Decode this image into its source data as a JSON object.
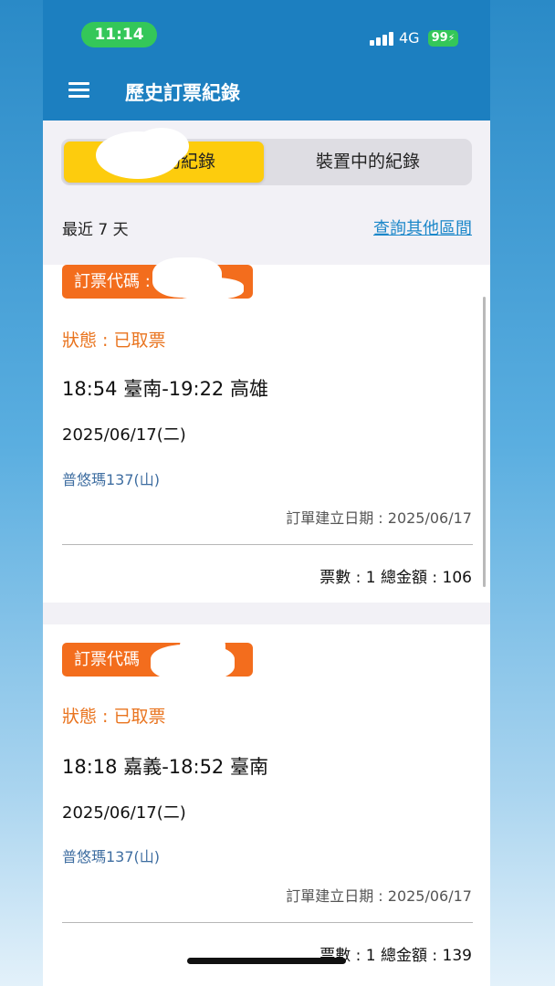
{
  "status_bar": {
    "time": "11:14",
    "network": "4G",
    "battery": "99"
  },
  "nav": {
    "title": "歷史訂票紀錄"
  },
  "segment": {
    "active_label": "的紀錄",
    "inactive_label": "裝置中的紀錄"
  },
  "filter": {
    "range_label": "最近 7 天",
    "other_range_link": "查詢其他區間"
  },
  "records": [
    {
      "code_label": "訂票代碼 :",
      "status": "狀態 : 已取票",
      "route": "18:54 臺南-19:22 高雄",
      "date": "2025/06/17(二)",
      "train": "普悠瑪137(山)",
      "created": "訂單建立日期 : 2025/06/17",
      "total": "票數 : 1  總金額 : 106"
    },
    {
      "code_label": "訂票代碼",
      "status": "狀態 : 已取票",
      "route": "18:18 嘉義-18:52 臺南",
      "date": "2025/06/17(二)",
      "train": "普悠瑪137(山)",
      "created": "訂單建立日期 : 2025/06/17",
      "total": "票數 : 1  總金額 : 139"
    }
  ],
  "colors": {
    "header_blue": "#1c7fc0",
    "segment_active": "#fdcc0d",
    "badge_orange": "#f36d1d",
    "status_orange": "#e9741f",
    "link_blue": "#1b87c9",
    "train_blue": "#3f6ea1",
    "pill_green": "#34c759"
  },
  "icons": {
    "menu": "hamburger-menu-icon",
    "signal": "signal-bars-icon",
    "battery": "battery-charging-icon"
  }
}
